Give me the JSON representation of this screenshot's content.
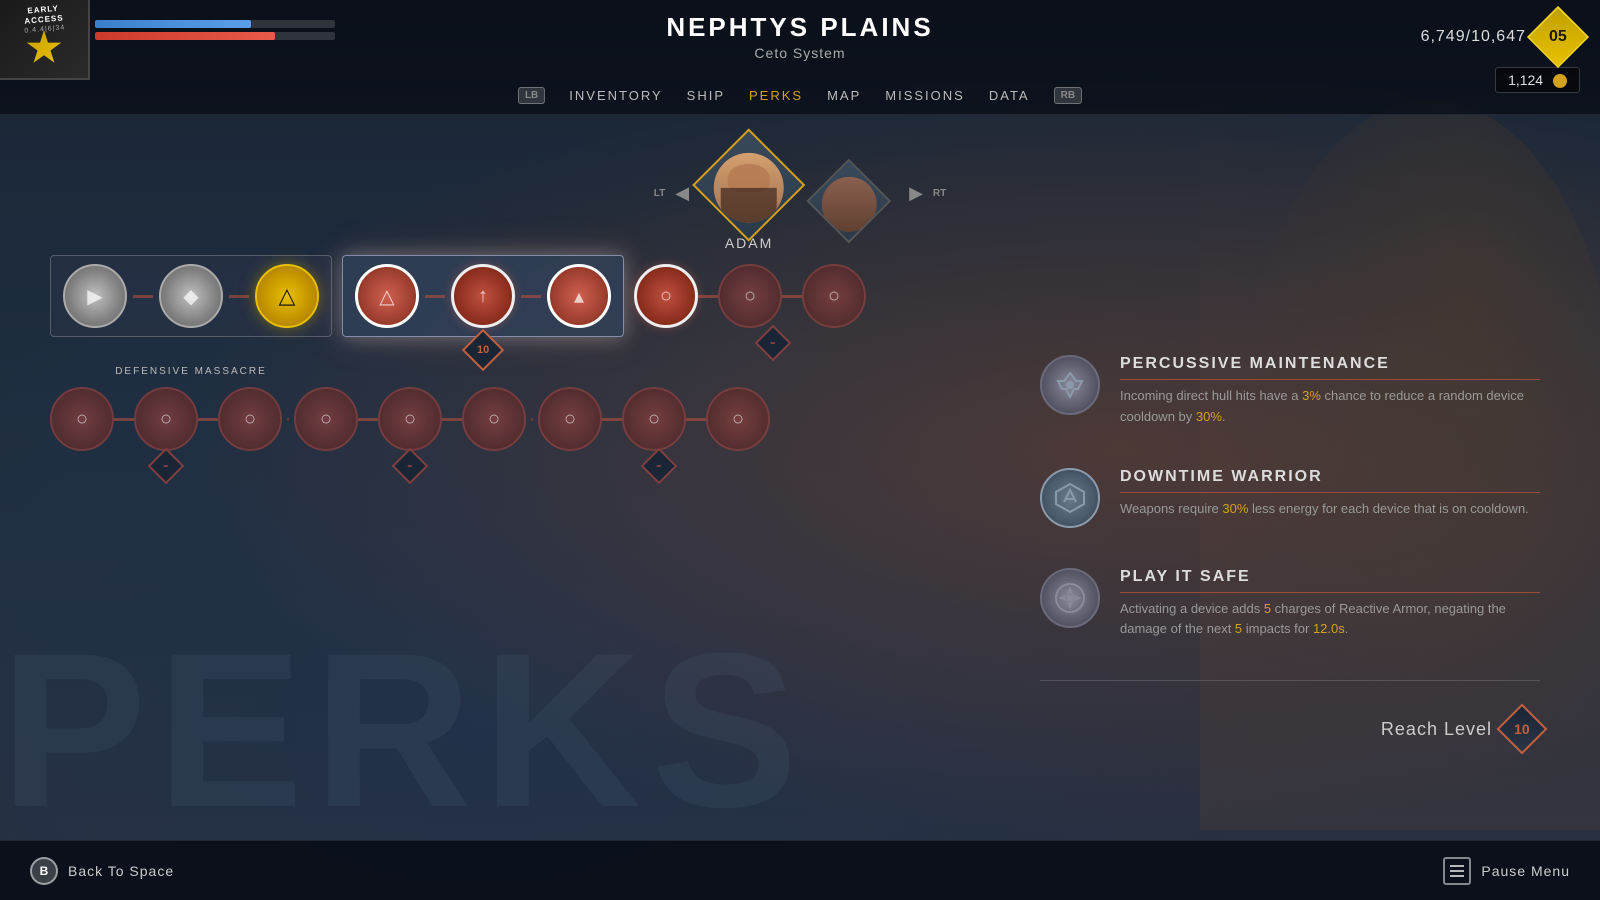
{
  "header": {
    "location": "NEPHTYS PLAINS",
    "system": "Ceto System",
    "early_access_line1": "EARLY",
    "early_access_line2": "ACCESS",
    "version": "0.4.4|6|34"
  },
  "hud": {
    "xp_current": "6,749",
    "xp_max": "10,647",
    "level": "05",
    "coins": "1,124"
  },
  "nav": {
    "left_bumper": "LB",
    "right_bumper": "RB",
    "items": [
      {
        "label": "INVENTORY",
        "active": false
      },
      {
        "label": "SHIP",
        "active": false
      },
      {
        "label": "PERKS",
        "active": true
      },
      {
        "label": "MAP",
        "active": false
      },
      {
        "label": "MISSIONS",
        "active": false
      },
      {
        "label": "DATA",
        "active": false
      }
    ]
  },
  "characters": {
    "left_trigger": "LT",
    "right_trigger": "RT",
    "active": {
      "name": "ADAM"
    },
    "inactive": {}
  },
  "perk_tree": {
    "skill_group_label": "DEFENSIVE MASSACRE",
    "level_indicator_1": "10",
    "dash_indicators": [
      "-",
      "-",
      "-",
      "-"
    ]
  },
  "perk_details": [
    {
      "id": "percussive_maintenance",
      "name": "PERCUSSIVE MAINTENANCE",
      "desc_parts": [
        {
          "text": "Incoming direct hull hits have a "
        },
        {
          "text": "3%",
          "highlight": true
        },
        {
          "text": " chance to reduce a random device cooldown by "
        },
        {
          "text": "30%",
          "highlight": true
        },
        {
          "text": "."
        }
      ]
    },
    {
      "id": "downtime_warrior",
      "name": "DOWNTIME WARRIOR",
      "desc_parts": [
        {
          "text": "Weapons require "
        },
        {
          "text": "30%",
          "highlight": true
        },
        {
          "text": " less energy for each device that is on cooldown."
        }
      ]
    },
    {
      "id": "play_it_safe",
      "name": "PLAY IT SAFE",
      "desc_parts": [
        {
          "text": "Activating a device adds "
        },
        {
          "text": "5",
          "highlight": true
        },
        {
          "text": " charges of Reactive Armor, negating the damage of the next "
        },
        {
          "text": "5",
          "highlight": true
        },
        {
          "text": " impacts for "
        },
        {
          "text": "12.0s",
          "highlight": true
        },
        {
          "text": "."
        }
      ]
    }
  ],
  "reach_level": {
    "label": "Reach Level",
    "value": "10"
  },
  "bottom_bar": {
    "back_button": "B",
    "back_label": "Back To Space",
    "menu_label": "Pause Menu"
  }
}
